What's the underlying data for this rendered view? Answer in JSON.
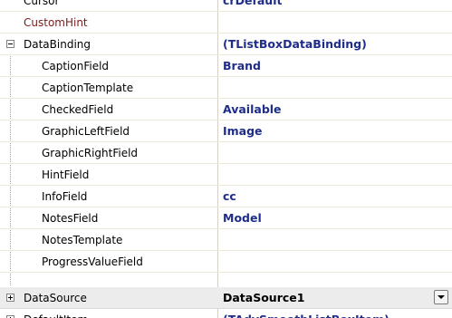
{
  "inspector": {
    "rows": [
      {
        "name": "Cursor",
        "value": "crDefault"
      },
      {
        "name": "CustomHint",
        "value": ""
      },
      {
        "name": "DataBinding",
        "value": "(TListBoxDataBinding)"
      },
      {
        "name": "CaptionField",
        "value": "Brand"
      },
      {
        "name": "CaptionTemplate",
        "value": ""
      },
      {
        "name": "CheckedField",
        "value": "Available"
      },
      {
        "name": "GraphicLeftField",
        "value": "Image"
      },
      {
        "name": "GraphicRightField",
        "value": ""
      },
      {
        "name": "HintField",
        "value": ""
      },
      {
        "name": "InfoField",
        "value": "cc"
      },
      {
        "name": "NotesField",
        "value": "Model"
      },
      {
        "name": "NotesTemplate",
        "value": ""
      },
      {
        "name": "ProgressValueField",
        "value": ""
      },
      {
        "name": "DataSource",
        "value": "DataSource1"
      },
      {
        "name": "DefaultItem",
        "value": "(TAdvSmoothListBoxItem)"
      }
    ],
    "colors": {
      "value_text": "#1f2d8a",
      "modified_name": "#7a1a1a",
      "grid_line": "#d4d0c8",
      "selected_row": "#ececec"
    },
    "icons": {
      "expanded": "minus-box-icon",
      "collapsed": "plus-box-icon",
      "dropdown": "dropdown-arrow-icon"
    }
  }
}
